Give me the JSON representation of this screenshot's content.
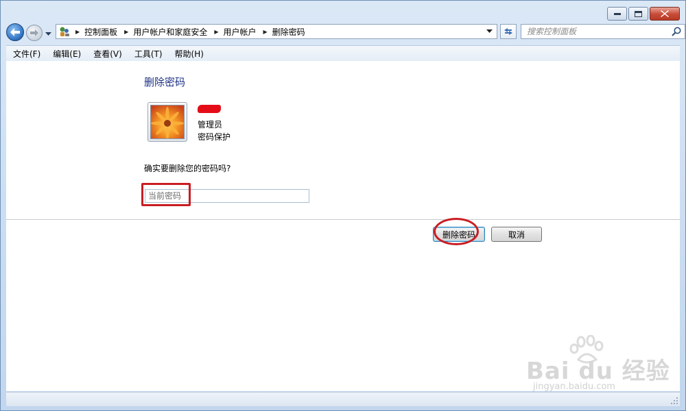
{
  "window": {
    "controls": {
      "minimize_icon": "minimize-icon",
      "maximize_icon": "maximize-icon",
      "close_icon": "close-icon"
    }
  },
  "nav": {
    "breadcrumbs": [
      "控制面板",
      "用户帐户和家庭安全",
      "用户帐户",
      "删除密码"
    ],
    "search_placeholder": "搜索控制面板"
  },
  "menu": [
    "文件(F)",
    "编辑(E)",
    "查看(V)",
    "工具(T)",
    "帮助(H)"
  ],
  "main": {
    "title": "删除密码",
    "user": {
      "role": "管理员",
      "status": "密码保护"
    },
    "question": "确实要删除您的密码吗?",
    "password_placeholder": "当前密码",
    "delete_button": "删除密码",
    "cancel_button": "取消"
  },
  "watermark": {
    "brand": "Bai du 经验",
    "url": "jingyan.baidu.com"
  },
  "colors": {
    "title_blue": "#1e3287",
    "annotation_red": "#c91c22",
    "redaction_red": "#e40d17"
  }
}
